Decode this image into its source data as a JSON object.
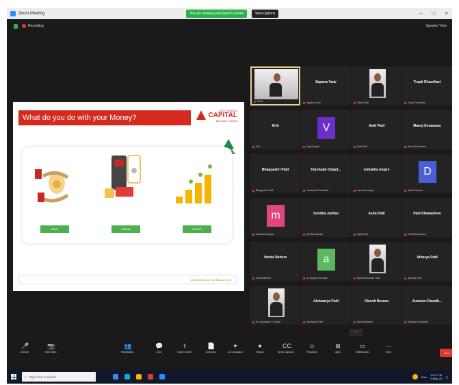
{
  "window": {
    "title": "Zoom Meeting",
    "sharing_banner": "You are viewing participant's screen",
    "view_options": "View Options"
  },
  "topbar": {
    "recording": "Recording",
    "speaker_view": "Speaker View"
  },
  "slide": {
    "header": "What do you do with your Money?",
    "logo_top": "ADITYA BIRLA",
    "logo_main": "CAPITAL",
    "logo_bottom": "MUTUAL FUNDS",
    "tree_label": "AURORA",
    "buttons": [
      "SAVE",
      "SPEND",
      "INVEST"
    ],
    "footer": "Aditya Birla Sun Life Mutual Fund"
  },
  "participants": [
    {
      "name": "",
      "label": "Rohit",
      "type": "video"
    },
    {
      "name": "Sapana Yadv",
      "label": "Sapana Yadv",
      "type": "name"
    },
    {
      "name": "",
      "label": "Vithal Patil",
      "type": "photo"
    },
    {
      "name": "Trupti Chaudhari",
      "label": "Trupti Chaudhari",
      "type": "name"
    },
    {
      "name": "Kirti",
      "label": "Kirti",
      "type": "name"
    },
    {
      "name": "V",
      "label": "Vijay Dange",
      "type": "avatar",
      "color": "#6a2fc6"
    },
    {
      "name": "Amit Patil",
      "label": "Amit Patil",
      "type": "name"
    },
    {
      "name": "Manoj Sonawane",
      "label": "Manoj Sonawane",
      "type": "name"
    },
    {
      "name": "Bhagyashri Patil",
      "label": "Bhagyashri Patil",
      "type": "name"
    },
    {
      "name": "Harshada Chaud...",
      "label": "Harshada Chaudhari",
      "type": "name"
    },
    {
      "name": "vishakha mogre",
      "label": "vishakha mogre",
      "type": "name"
    },
    {
      "name": "D",
      "label": "Dipali Dhande",
      "type": "avatar",
      "color": "#4a5fd6"
    },
    {
      "name": "m",
      "label": "manisha bhange",
      "type": "avatar",
      "color": "#e0457b"
    },
    {
      "name": "Sunitha Jadhav",
      "label": "Sunitha Jadhav",
      "type": "name"
    },
    {
      "name": "Asha Patil",
      "label": "Asha Patil",
      "type": "name"
    },
    {
      "name": "Patil Dhanashree",
      "label": "Patil Dhanashree",
      "type": "name"
    },
    {
      "name": "Vrinda Behere",
      "label": "Vrinda Behere",
      "type": "name"
    },
    {
      "name": "a",
      "label": "Ar Sugrah Chikhagi",
      "type": "avatar",
      "color": "#5cb85c"
    },
    {
      "name": "",
      "label": "Machhindranath Patil",
      "type": "photo"
    },
    {
      "name": "Atharya Patil",
      "label": "Atharya Patil",
      "type": "name"
    },
    {
      "name": "",
      "label": "Dr. Laxmikant D Tawari",
      "type": "photo"
    },
    {
      "name": "Aishwarya Patil",
      "label": "Aishwarya Patil",
      "type": "name"
    },
    {
      "name": "Dinesh Borase",
      "label": "Dinesh Borase",
      "type": "name"
    },
    {
      "name": "Susama Chaudh...",
      "label": "Susama Chaudhari",
      "type": "name"
    }
  ],
  "toolbar": [
    {
      "label": "Unmute",
      "icon": "🎤"
    },
    {
      "label": "Start Video",
      "icon": "📷"
    },
    {
      "label": "Participants",
      "icon": "👥"
    },
    {
      "label": "Chat",
      "icon": "💬"
    },
    {
      "label": "Share Screen",
      "icon": "⬆"
    },
    {
      "label": "Summary",
      "icon": "📄"
    },
    {
      "label": "AI Companion",
      "icon": "✦"
    },
    {
      "label": "Record",
      "icon": "⏺"
    },
    {
      "label": "Show Captions",
      "icon": "CC"
    },
    {
      "label": "Reactions",
      "icon": "☺"
    },
    {
      "label": "Apps",
      "icon": "⊞"
    },
    {
      "label": "Whiteboards",
      "icon": "▭"
    },
    {
      "label": "More",
      "icon": "⋯"
    }
  ],
  "end_label": "End",
  "taskbar": {
    "search_placeholder": "Type here to search",
    "time": "12:21 PM",
    "date": "9-May-24",
    "weather": "Rain"
  }
}
